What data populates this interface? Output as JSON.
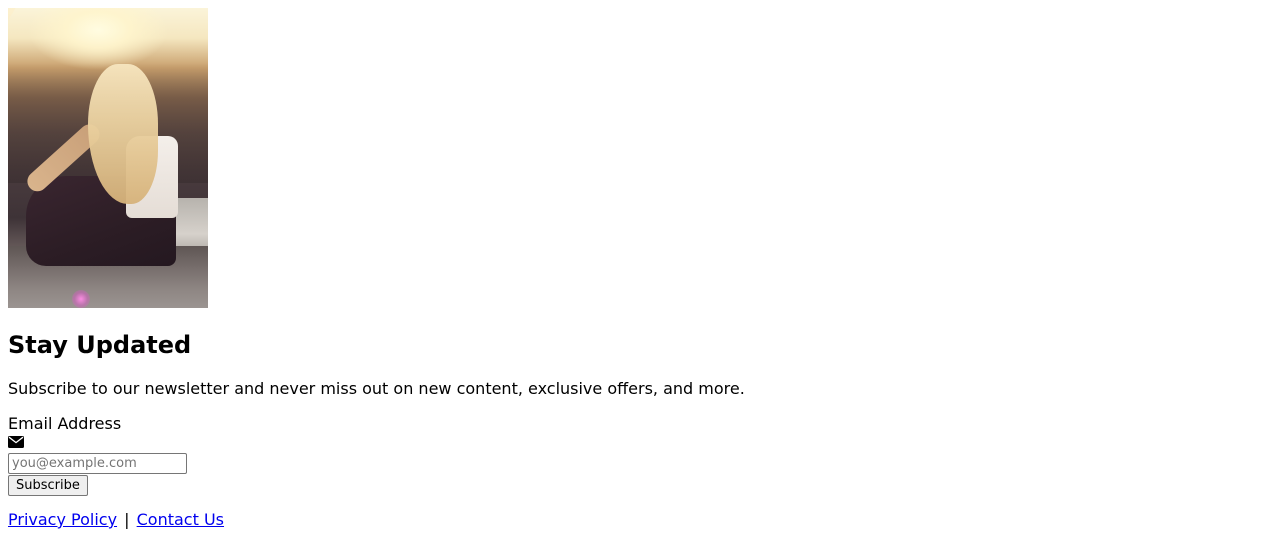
{
  "hero": {
    "image_alt": "Woman sitting on a rock at sunset"
  },
  "newsletter": {
    "heading": "Stay Updated",
    "description": "Subscribe to our newsletter and never miss out on new content, exclusive offers, and more.",
    "email_label": "Email Address",
    "email_icon": "envelope-icon",
    "email_placeholder": "you@example.com",
    "email_value": "",
    "subscribe_label": "Subscribe"
  },
  "footer": {
    "links": [
      {
        "label": "Privacy Policy"
      },
      {
        "label": "Contact Us"
      }
    ],
    "separator": "|"
  }
}
